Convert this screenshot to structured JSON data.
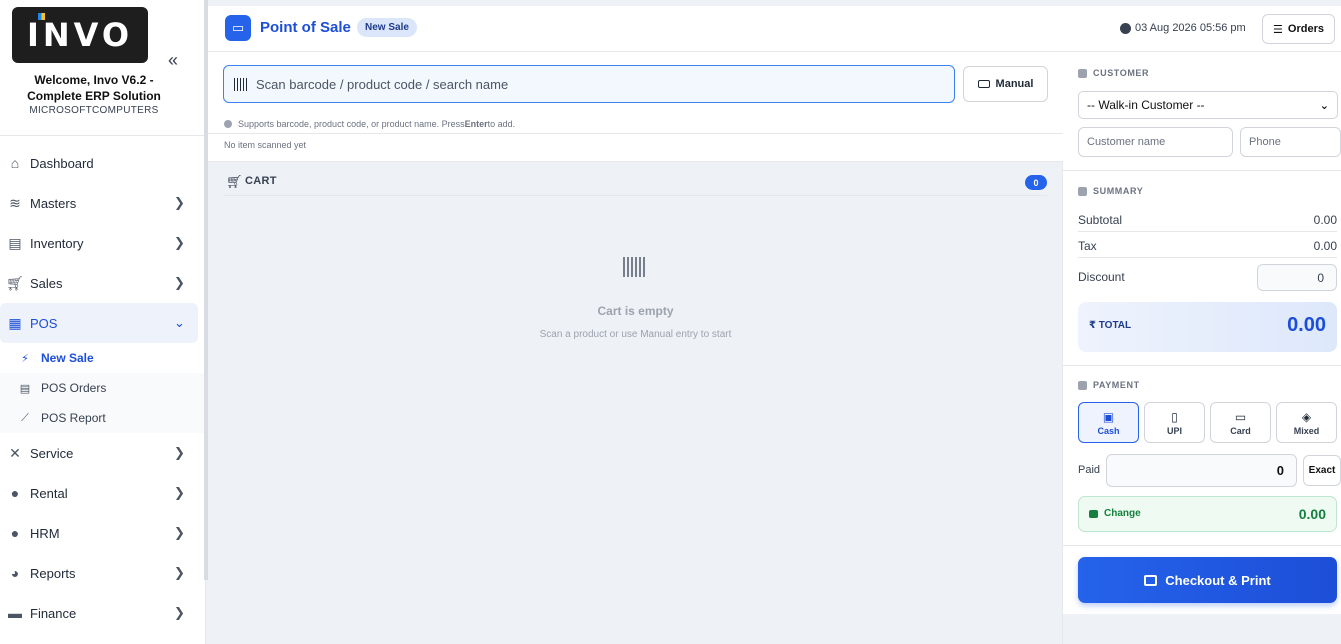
{
  "sidebar": {
    "logo_text": "INVO",
    "welcome": "Welcome, Invo V6.2 - Complete ERP Solution",
    "company": "MICROSOFTCOMPUTERS",
    "items": [
      {
        "label": "Dashboard",
        "icon": "home-icon",
        "has_chevron": false
      },
      {
        "label": "Masters",
        "icon": "database-icon",
        "has_chevron": true
      },
      {
        "label": "Inventory",
        "icon": "warehouse-icon",
        "has_chevron": true
      },
      {
        "label": "Sales",
        "icon": "cart-icon",
        "has_chevron": true
      },
      {
        "label": "POS",
        "icon": "cash-register-icon",
        "has_chevron": true,
        "expanded": true
      },
      {
        "label": "Service",
        "icon": "tools-icon",
        "has_chevron": true
      },
      {
        "label": "Rental",
        "icon": "microphone-icon",
        "has_chevron": true
      },
      {
        "label": "HRM",
        "icon": "user-tie-icon",
        "has_chevron": true
      },
      {
        "label": "Reports",
        "icon": "pie-chart-icon",
        "has_chevron": true
      },
      {
        "label": "Finance",
        "icon": "wallet-icon",
        "has_chevron": true
      }
    ],
    "pos_sub": [
      {
        "label": "New Sale",
        "icon": "bolt-icon"
      },
      {
        "label": "POS Orders",
        "icon": "receipt-icon"
      },
      {
        "label": "POS Report",
        "icon": "line-chart-icon"
      }
    ]
  },
  "header": {
    "title": "Point of Sale",
    "badge": "New Sale",
    "datetime": "03 Aug 2026 05:56 pm",
    "orders_label": "Orders"
  },
  "scan": {
    "placeholder": "Scan barcode / product code / search name",
    "manual_label": "Manual",
    "hint_prefix": "Supports barcode, product code, or product name. Press ",
    "hint_key": "Enter",
    "hint_suffix": " to add.",
    "last_item": "No item scanned yet"
  },
  "cart": {
    "title": "CART",
    "count": "0",
    "empty_title": "Cart is empty",
    "empty_sub": "Scan a product or use Manual entry to start"
  },
  "customer": {
    "label": "CUSTOMER",
    "selected": "-- Walk-in Customer --",
    "name_placeholder": "Customer name",
    "phone_placeholder": "Phone"
  },
  "summary": {
    "label": "SUMMARY",
    "subtotal_label": "Subtotal",
    "subtotal": "0.00",
    "tax_label": "Tax",
    "tax": "0.00",
    "discount_label": "Discount",
    "discount": "0",
    "total_label": "₹ TOTAL",
    "total": "0.00"
  },
  "payment": {
    "label": "PAYMENT",
    "methods": [
      {
        "label": "Cash",
        "icon": "money-bill-icon"
      },
      {
        "label": "UPI",
        "icon": "mobile-icon"
      },
      {
        "label": "Card",
        "icon": "credit-card-icon"
      },
      {
        "label": "Mixed",
        "icon": "layers-icon"
      }
    ],
    "active_method": "Cash",
    "paid_label": "Paid",
    "paid": "0",
    "exact_label": "Exact",
    "change_label": "Change",
    "change": "0.00"
  },
  "checkout": {
    "label": "Checkout & Print"
  },
  "colors": {
    "accent": "#2563eb",
    "success": "#15803d",
    "sidebar_active_bg": "#eef2fb"
  }
}
